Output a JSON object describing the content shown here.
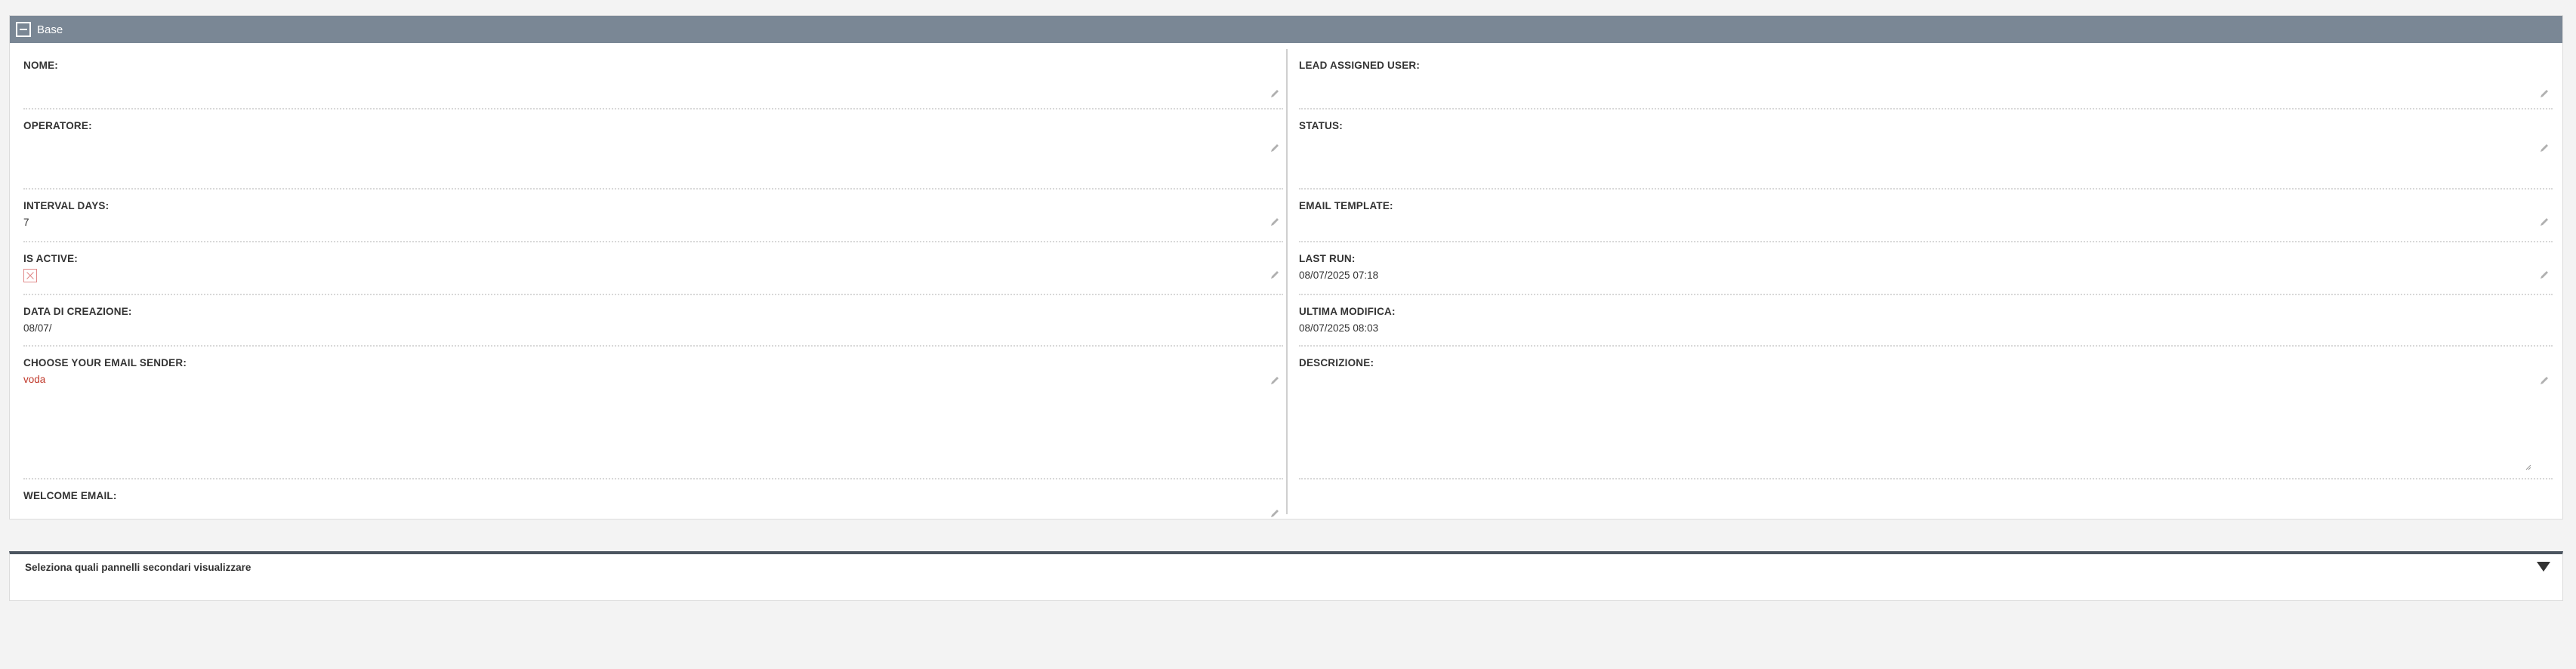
{
  "panel": {
    "title": "Base"
  },
  "left_fields": {
    "nome": {
      "label": "NOME:",
      "value": ""
    },
    "operatore": {
      "label": "OPERATORE:",
      "value": ""
    },
    "interval_days": {
      "label": "INTERVAL DAYS:",
      "value": "7"
    },
    "is_active": {
      "label": "IS ACTIVE:",
      "checked": false
    },
    "data_creazione": {
      "label": "DATA DI CREAZIONE:",
      "value": "08/07/"
    },
    "email_sender": {
      "label": "CHOOSE YOUR EMAIL SENDER:",
      "value": "voda"
    },
    "welcome_email": {
      "label": "WELCOME EMAIL:",
      "value": ""
    }
  },
  "right_fields": {
    "lead_assigned_user": {
      "label": "LEAD ASSIGNED USER:",
      "value": ""
    },
    "status": {
      "label": "STATUS:",
      "value": ""
    },
    "email_template": {
      "label": "EMAIL TEMPLATE:",
      "value": ""
    },
    "last_run": {
      "label": "LAST RUN:",
      "value": "08/07/2025 07:18"
    },
    "ultima_modifica": {
      "label": "ULTIMA MODIFICA:",
      "value": "08/07/2025 08:03"
    },
    "descrizione": {
      "label": "DESCRIZIONE:",
      "value": ""
    }
  },
  "secondary_panels": {
    "label": "Seleziona quali pannelli secondari visualizzare"
  },
  "colors": {
    "header_bg": "#7a8795",
    "link": "#c0392b",
    "secondary_border": "#4c5560"
  },
  "icons": {
    "edit": "pencil-icon",
    "collapse": "minus-icon",
    "expand": "triangle-down-icon"
  }
}
